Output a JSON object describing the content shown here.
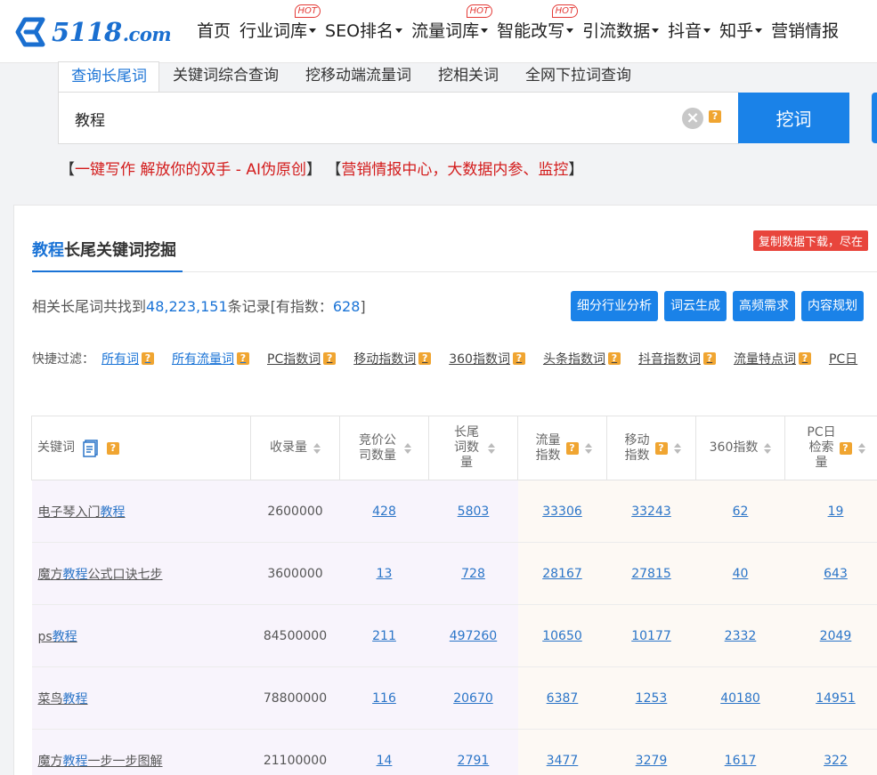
{
  "brand": {
    "logo_text": "5118",
    "logo_suffix": ".com"
  },
  "nav": {
    "items": [
      {
        "label": "首页",
        "caret": false,
        "hot": false
      },
      {
        "label": "行业词库",
        "caret": true,
        "hot": true
      },
      {
        "label": "SEO排名",
        "caret": true,
        "hot": false
      },
      {
        "label": "流量词库",
        "caret": true,
        "hot": true
      },
      {
        "label": "智能改写",
        "caret": true,
        "hot": true
      },
      {
        "label": "引流数据",
        "caret": true,
        "hot": false
      },
      {
        "label": "抖音",
        "caret": true,
        "hot": false
      },
      {
        "label": "知乎",
        "caret": true,
        "hot": false
      },
      {
        "label": "营销情报",
        "caret": false,
        "hot": false
      }
    ],
    "hot_label": "HOT"
  },
  "search": {
    "tabs": [
      "查询长尾词",
      "关键词综合查询",
      "挖移动端流量词",
      "挖相关词",
      "全网下拉词查询"
    ],
    "active_tab": 0,
    "query": "教程",
    "button_label": "挖词"
  },
  "promo": {
    "open1": "【",
    "text1": "一键写作 解放你的双手 - AI伪原创",
    "close1": "】",
    "open2": "【",
    "text2": "营销情报中心，大数据内参、监控",
    "close2": "】"
  },
  "panel": {
    "title_keyword": "教程",
    "title_suffix": "长尾关键词挖掘",
    "copy_badge": "复制数据下载，尽在",
    "summary_prefix": "相关长尾词共找到",
    "summary_count": "48,223,151",
    "summary_mid": "条记录[有指数：",
    "summary_index": "628",
    "summary_end": "]",
    "actions": [
      "细分行业分析",
      "词云生成",
      "高频需求",
      "内容规划"
    ]
  },
  "filters": {
    "label": "快捷过滤：",
    "items": [
      "所有词",
      "所有流量词",
      "PC指数词",
      "移动指数词",
      "360指数词",
      "头条指数词",
      "抖音指数词",
      "流量特点词",
      "PC日"
    ]
  },
  "table": {
    "headers": [
      "关键词",
      "收录量",
      "竞价公司数量",
      "长尾词数量",
      "流量指数",
      "移动指数",
      "360指数",
      "PC日检索量"
    ],
    "rows": [
      {
        "kw_pre": "电子琴入门",
        "kw_hl": "教程",
        "kw_post": "",
        "index_count": "2600000",
        "bid": "428",
        "longtail": "5803",
        "flow": "33306",
        "mobile": "33243",
        "i360": "62",
        "pcday": "19"
      },
      {
        "kw_pre": "魔方",
        "kw_hl": "教程",
        "kw_post": "公式口诀七步",
        "index_count": "3600000",
        "bid": "13",
        "longtail": "728",
        "flow": "28167",
        "mobile": "27815",
        "i360": "40",
        "pcday": "643"
      },
      {
        "kw_pre": "ps",
        "kw_hl": "教程",
        "kw_post": "",
        "index_count": "84500000",
        "bid": "211",
        "longtail": "497260",
        "flow": "10650",
        "mobile": "10177",
        "i360": "2332",
        "pcday": "2049"
      },
      {
        "kw_pre": "菜鸟",
        "kw_hl": "教程",
        "kw_post": "",
        "index_count": "78800000",
        "bid": "116",
        "longtail": "20670",
        "flow": "6387",
        "mobile": "1253",
        "i360": "40180",
        "pcday": "14951"
      },
      {
        "kw_pre": "魔方",
        "kw_hl": "教程",
        "kw_post": "一步一步图解",
        "index_count": "21100000",
        "bid": "14",
        "longtail": "2791",
        "flow": "3477",
        "mobile": "3279",
        "i360": "1617",
        "pcday": "322"
      }
    ]
  },
  "colors": {
    "brand_blue": "#1a82e8",
    "link_blue": "#2b75c8",
    "promo_red": "#d31c1c",
    "hot_red": "#e43a36",
    "help_orange": "#f0a531"
  }
}
